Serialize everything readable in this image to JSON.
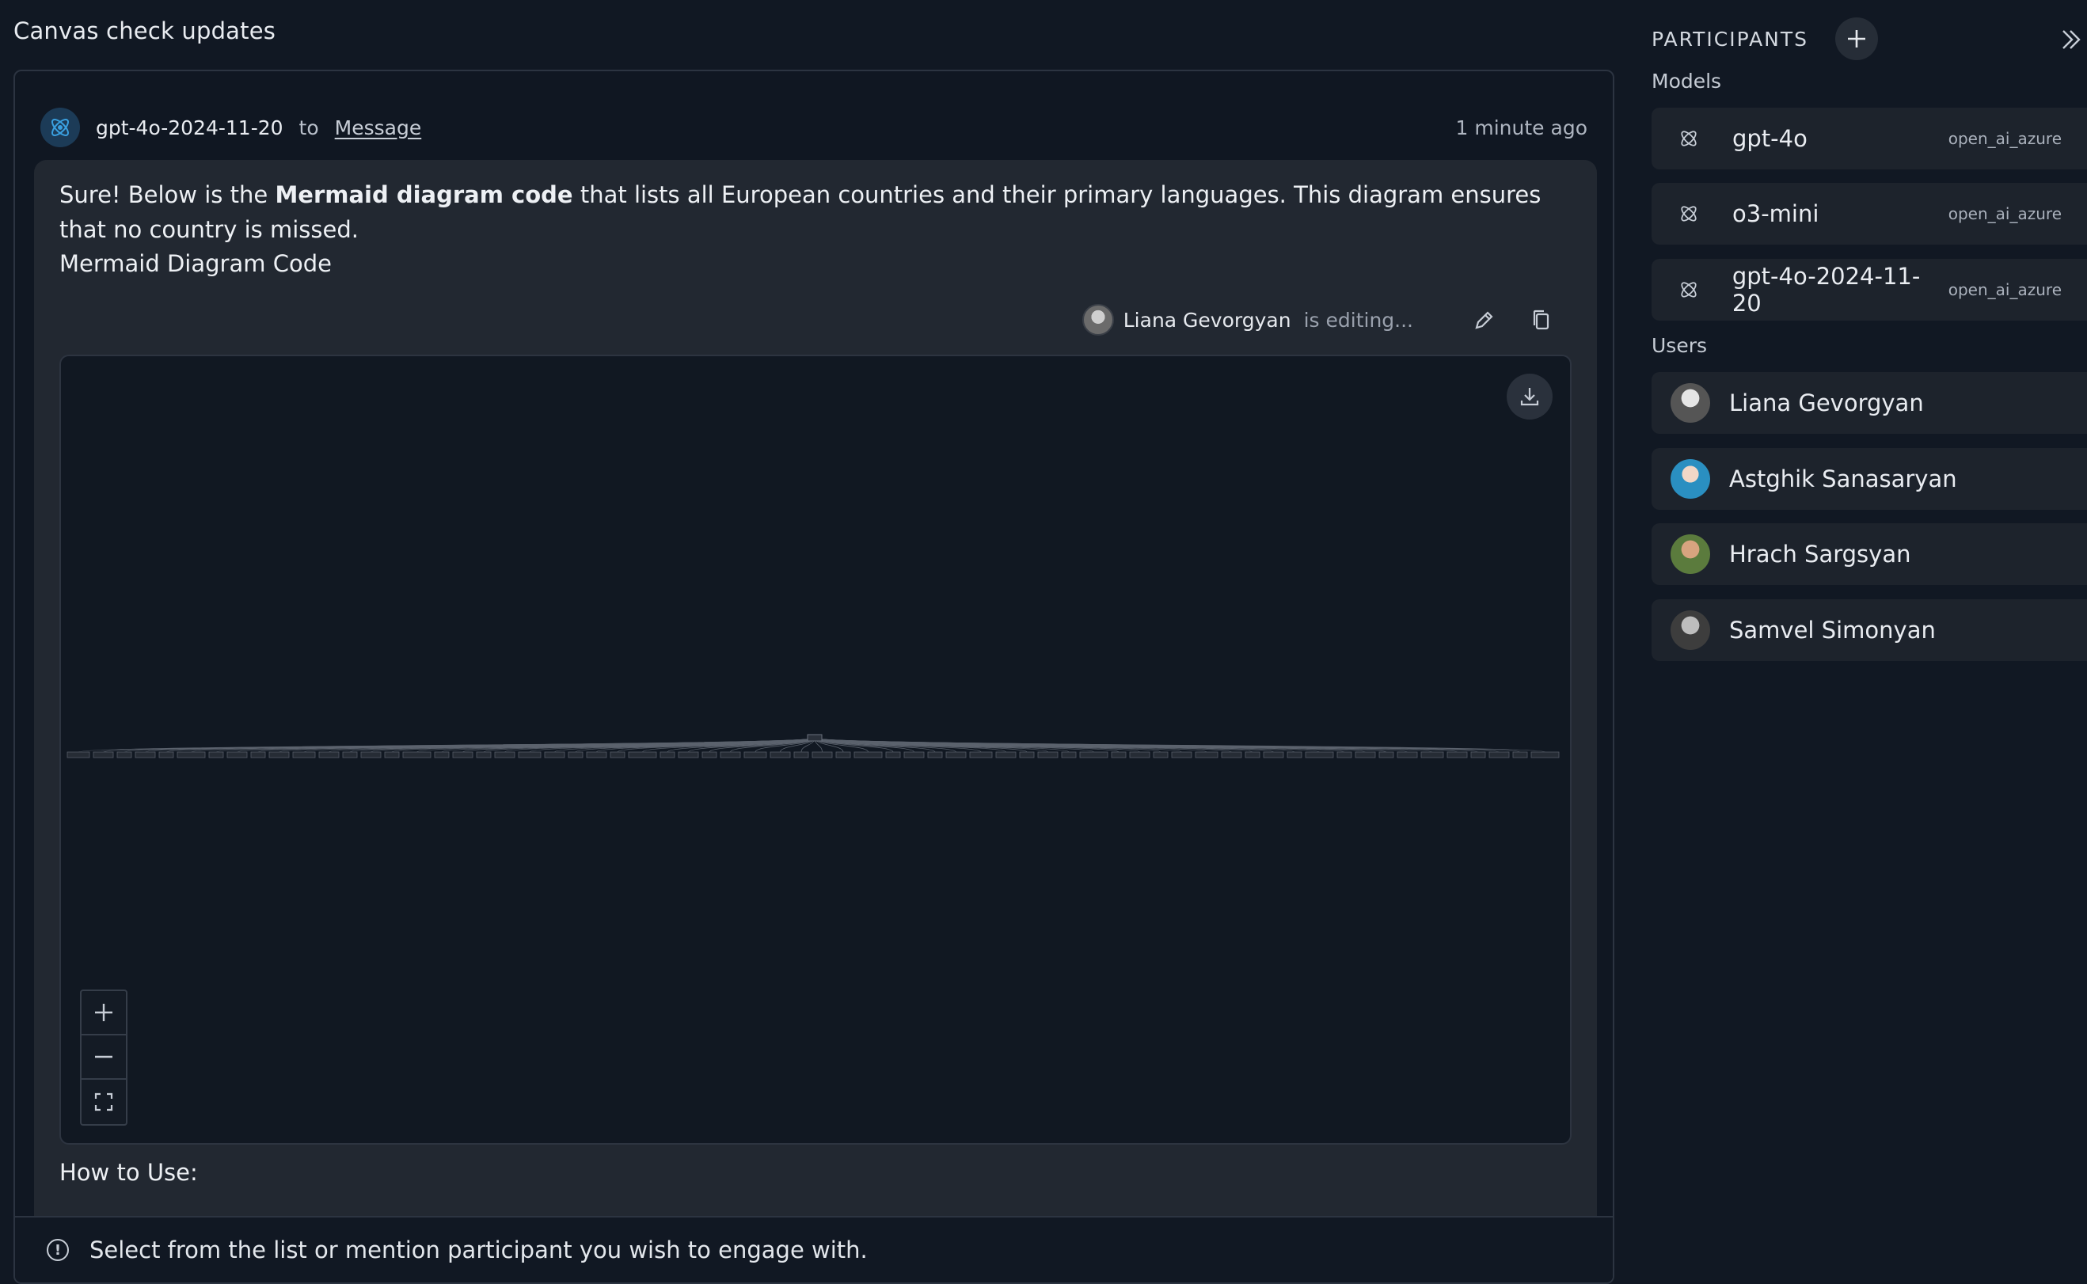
{
  "page": {
    "title": "Canvas check updates"
  },
  "message": {
    "sender": "gpt-4o-2024-11-20",
    "to_word": "to",
    "target": "Message",
    "timestamp": "1 minute ago",
    "intro_before": "Sure! Below is the ",
    "intro_bold": "Mermaid diagram code",
    "intro_after": " that lists all European countries and their primary languages. This diagram ensures that no country is missed.",
    "section_heading": "Mermaid Diagram Code",
    "next_heading": "How to Use:"
  },
  "canvas": {
    "editor_name": "Liana Gevorgyan",
    "editor_status": "is editing...",
    "icons": {
      "edit": "pencil-icon",
      "copy": "copy-icon",
      "download": "download-icon"
    },
    "zoom": {
      "in": "+",
      "out": "—",
      "fit": "fit-screen-icon"
    }
  },
  "notice": {
    "text": "Select from the list or mention participant you wish to engage with."
  },
  "participants": {
    "title": "PARTICIPANTS",
    "models_label": "Models",
    "users_label": "Users",
    "models": [
      {
        "name": "gpt-4o",
        "provider": "open_ai_azure"
      },
      {
        "name": "o3-mini",
        "provider": "open_ai_azure"
      },
      {
        "name": "gpt-4o-2024-11-20",
        "provider": "open_ai_azure"
      }
    ],
    "users": [
      {
        "name": "Liana Gevorgyan"
      },
      {
        "name": "Astghik Sanasaryan"
      },
      {
        "name": "Hrach Sargsyan"
      },
      {
        "name": "Samvel Simonyan"
      }
    ]
  },
  "colors": {
    "background": "#111823",
    "panel": "#222831",
    "row": "#1d232c",
    "accent": "#3aa0e0"
  }
}
